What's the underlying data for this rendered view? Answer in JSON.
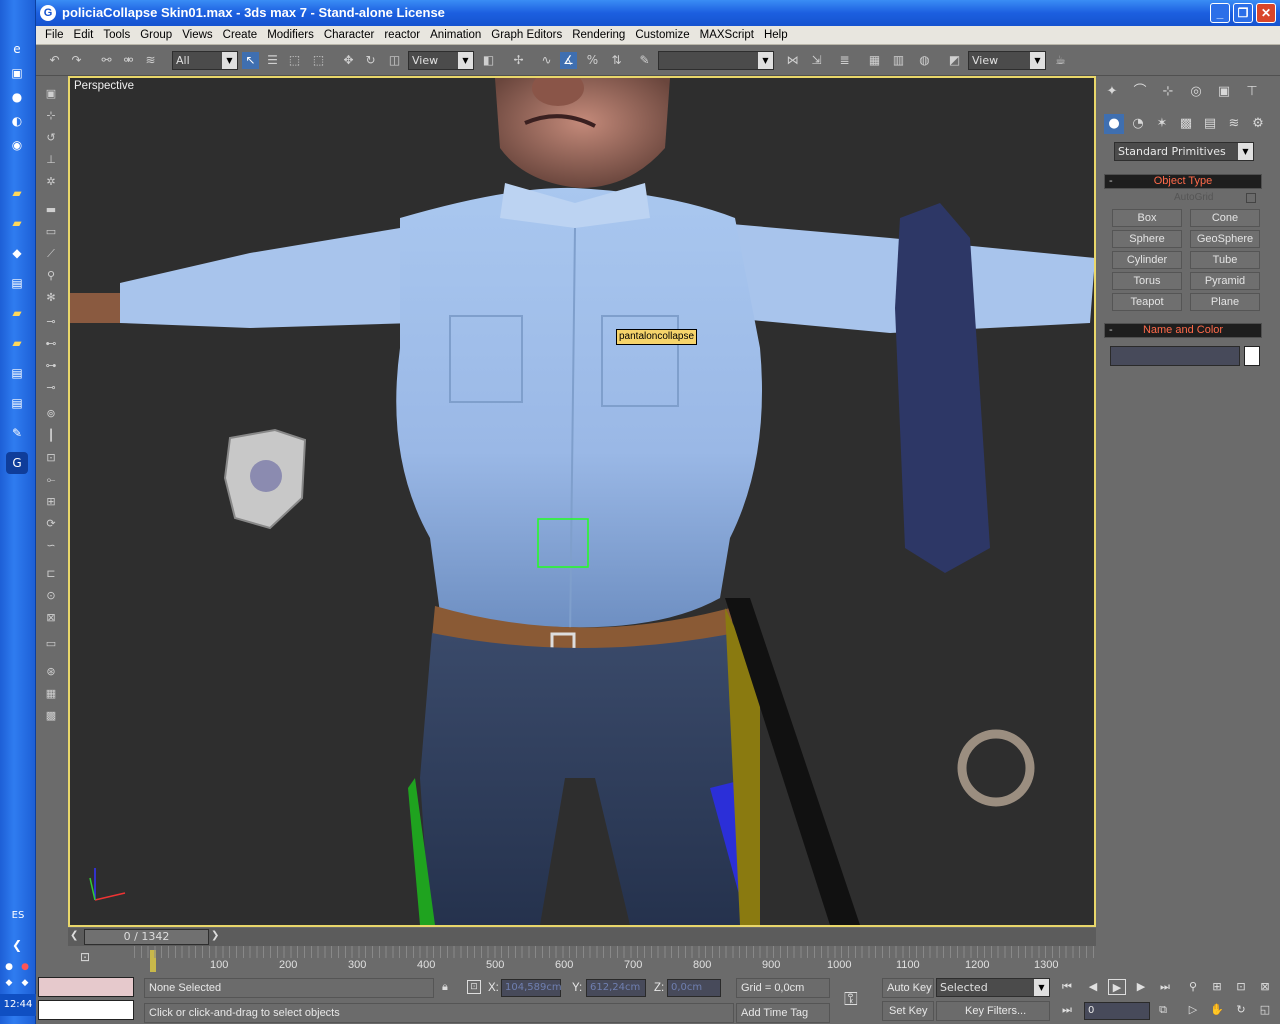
{
  "window": {
    "title": "policiaCollapse Skin01.max - 3ds max 7  - Stand-alone License",
    "minimize": "_",
    "maximize": "❐",
    "close": "✕"
  },
  "taskbar": {
    "lang": "ES",
    "clock": "12:44"
  },
  "menu": [
    "File",
    "Edit",
    "Tools",
    "Group",
    "Views",
    "Create",
    "Modifiers",
    "Character",
    "reactor",
    "Animation",
    "Graph Editors",
    "Rendering",
    "Customize",
    "MAXScript",
    "Help"
  ],
  "toolbar": {
    "selection_filter": "All",
    "ref_coord": "View",
    "named_sel": "",
    "render_view": "View"
  },
  "viewport": {
    "label": "Perspective",
    "tooltip": "pantaloncollapse"
  },
  "command_panel": {
    "category": "Standard Primitives",
    "object_type_title": "Object Type",
    "autogrid": "AutoGrid",
    "buttons": [
      "Box",
      "Cone",
      "Sphere",
      "GeoSphere",
      "Cylinder",
      "Tube",
      "Torus",
      "Pyramid",
      "Teapot",
      "Plane"
    ],
    "name_color_title": "Name and Color",
    "name_value": ""
  },
  "timeline": {
    "frame": "0 / 1342",
    "ticks": [
      "100",
      "200",
      "300",
      "400",
      "500",
      "600",
      "700",
      "800",
      "900",
      "1000",
      "1100",
      "1200",
      "1300"
    ]
  },
  "status": {
    "selection": "None Selected",
    "prompt": "Click or click-and-drag to select objects",
    "x_label": "X:",
    "x_value": "104,589cm",
    "y_label": "Y:",
    "y_value": "612,24cm",
    "z_label": "Z:",
    "z_value": "0,0cm",
    "grid": "Grid = 0,0cm",
    "add_time_tag": "Add Time Tag",
    "auto_key": "Auto Key",
    "set_key": "Set Key",
    "key_mode": "Selected",
    "key_filters": "Key Filters...",
    "current_frame": "0"
  }
}
